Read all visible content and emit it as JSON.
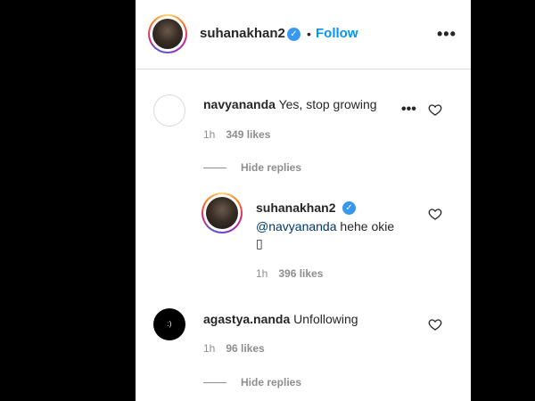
{
  "post": {
    "author": "suhanakhan2",
    "separator": "•",
    "follow_label": "Follow",
    "more_label": "•••"
  },
  "comments": [
    {
      "username": "navyananda",
      "text": "Yes, stop growing",
      "time": "1h",
      "likes": "349 likes",
      "options_label": "•••",
      "hide_replies_label": "Hide replies",
      "replies": [
        {
          "username": "suhanakhan2",
          "mention": "@navyananda",
          "text": " hehe okie",
          "emoji": "▯",
          "time": "1h",
          "likes": "396 likes"
        }
      ]
    },
    {
      "username": "agastya.nanda",
      "text": "Unfollowing",
      "time": "1h",
      "likes": "96 likes",
      "hide_replies_label": "Hide replies"
    }
  ],
  "icons": {
    "verified": "verified-badge-icon",
    "heart": "heart-outline-icon",
    "more": "more-horizontal-icon"
  },
  "colors": {
    "follow": "#0095f6",
    "verified": "#3897f0",
    "meta": "#8e8e8e",
    "text": "#262626"
  }
}
